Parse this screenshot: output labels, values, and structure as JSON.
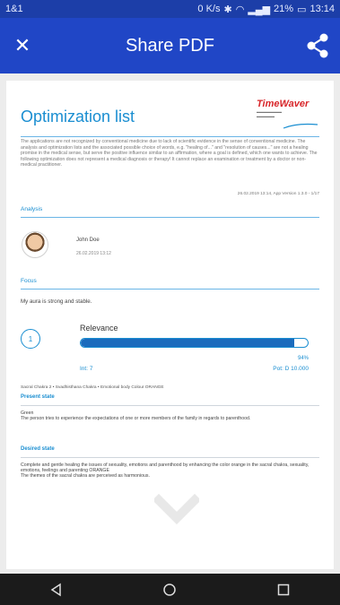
{
  "status_bar": {
    "carrier": "1&1",
    "speed": "0 K/s",
    "battery": "21%",
    "time": "13:14"
  },
  "app_bar": {
    "title": "Share PDF",
    "close_icon": "close-icon",
    "share_icon": "share-icon"
  },
  "document": {
    "title": "Optimization list",
    "logo_text": "TimeWaver",
    "disclaimer": "The applications are not recognized by conventional medicine due to lack of scientific evidence in the sense of conventional medicine. The analysis and optimization lists and the associated possible choice of words, e.g. \"healing of...\" and \"resolution of causes...\" are not a healing promise in the medical sense, but serve the positive influence similar to an affirmation, where a goal is defined, which one wants to achieve. The following optimization does not represent a medical diagnosis or therapy! It cannot replace an examination or treatment by a doctor or non-medical practitioner.",
    "dateline": "26.02.2019 13:14, App Version 1.3.0 - 1/17",
    "analysis_label": "Analysis",
    "person_name": "John Doe",
    "person_date": "26.02.2019 13:12",
    "focus_label": "Focus",
    "focus_text": "My aura is strong and stable.",
    "item_number": "1",
    "relevance_label": "Relevance",
    "relevance_percent": "94%",
    "relevance_value": 0.94,
    "int_label": "Int: 7",
    "pot_label": "Pot: D 10.000",
    "chakra_line": "Sacral Chakra 2 • Svadhisthana Chakra • Emotional body Colour ORANGE",
    "present_state_title": "Present state",
    "present_state_text": "Green\nThe person tries to experience the expectations of one or more members of the family in regards to parenthood.",
    "desired_state_title": "Desired state",
    "desired_state_text": "Complete and gentle healing the issues of sexuality, emotions and parenthood by enhancing the color orange in the sacral chakra, sexuality, emotions, feelings and parenting ORANGE\nThe themes of the sacral chakra are perceived as harmonious."
  },
  "nav_bar": {
    "back_icon": "back-icon",
    "home_icon": "home-icon",
    "recents_icon": "recents-icon"
  },
  "colors": {
    "app_bar": "#2046c6",
    "status_bar": "#1c3ea8",
    "accent": "#1a8ed1",
    "bar_fill": "#1a6bbd",
    "logo_red": "#d8262a"
  }
}
